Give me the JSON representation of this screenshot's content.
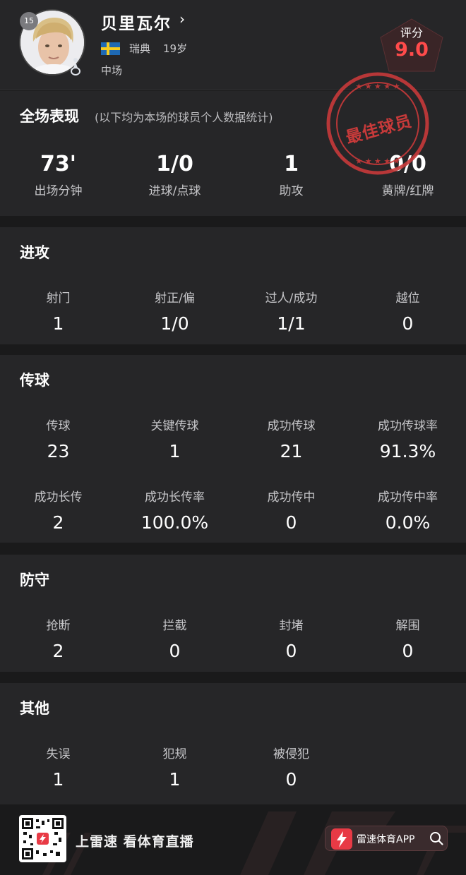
{
  "player": {
    "number": "15",
    "name": "贝里瓦尔",
    "chevron": "›",
    "country": "瑞典",
    "age": "19岁",
    "position": "中场",
    "flag_icon": "sweden-flag-icon",
    "club_icon": "tottenham-crest-icon"
  },
  "rating": {
    "label": "评分",
    "value": "9.0",
    "color": "#ff4b4b"
  },
  "overview": {
    "title": "全场表现",
    "subtitle": "(以下均为本场的球员个人数据统计)",
    "stamp": "最佳球员",
    "stats": [
      {
        "value": "73'",
        "label": "出场分钟"
      },
      {
        "value": "1/0",
        "label": "进球/点球"
      },
      {
        "value": "1",
        "label": "助攻"
      },
      {
        "value": "0/0",
        "label": "黄牌/红牌"
      }
    ]
  },
  "sections": {
    "attack": {
      "title": "进攻",
      "stats": [
        {
          "label": "射门",
          "value": "1"
        },
        {
          "label": "射正/偏",
          "value": "1/0"
        },
        {
          "label": "过人/成功",
          "value": "1/1"
        },
        {
          "label": "越位",
          "value": "0"
        }
      ]
    },
    "passing": {
      "title": "传球",
      "stats": [
        {
          "label": "传球",
          "value": "23"
        },
        {
          "label": "关键传球",
          "value": "1"
        },
        {
          "label": "成功传球",
          "value": "21"
        },
        {
          "label": "成功传球率",
          "value": "91.3%"
        },
        {
          "label": "成功长传",
          "value": "2"
        },
        {
          "label": "成功长传率",
          "value": "100.0%"
        },
        {
          "label": "成功传中",
          "value": "0"
        },
        {
          "label": "成功传中率",
          "value": "0.0%"
        }
      ]
    },
    "defense": {
      "title": "防守",
      "stats": [
        {
          "label": "抢断",
          "value": "2"
        },
        {
          "label": "拦截",
          "value": "0"
        },
        {
          "label": "封堵",
          "value": "0"
        },
        {
          "label": "解围",
          "value": "0"
        }
      ]
    },
    "other": {
      "title": "其他",
      "stats": [
        {
          "label": "失误",
          "value": "1"
        },
        {
          "label": "犯规",
          "value": "1"
        },
        {
          "label": "被侵犯",
          "value": "0"
        }
      ]
    }
  },
  "footer": {
    "slogan": "上雷速 看体育直播",
    "app_name": "雷速体育APP",
    "accent": "#e83a45"
  }
}
